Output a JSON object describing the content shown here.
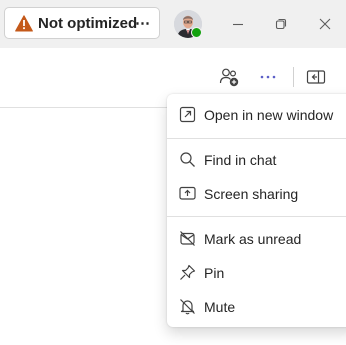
{
  "titlebar": {
    "status_button": {
      "label": "Not optimized",
      "icon": "warning-icon",
      "more_label": "⋯",
      "accent": "#c4591a"
    },
    "presence_color": "#13a10e",
    "controls": [
      "minimize-icon",
      "restore-icon",
      "close-icon"
    ]
  },
  "toolbar": {
    "icons": [
      "people-add-icon",
      "more-options-icon",
      "panel-collapse-icon"
    ],
    "more_color": "#5b5fc7"
  },
  "menu": {
    "items": [
      {
        "label": "Open in new window",
        "icon": "open-new-window-icon"
      },
      {
        "label": "Find in chat",
        "icon": "search-icon"
      },
      {
        "label": "Screen sharing",
        "icon": "screen-share-icon"
      },
      {
        "label": "Mark as unread",
        "icon": "mark-unread-icon"
      },
      {
        "label": "Pin",
        "icon": "pin-icon"
      },
      {
        "label": "Mute",
        "icon": "mute-bell-icon"
      }
    ]
  }
}
